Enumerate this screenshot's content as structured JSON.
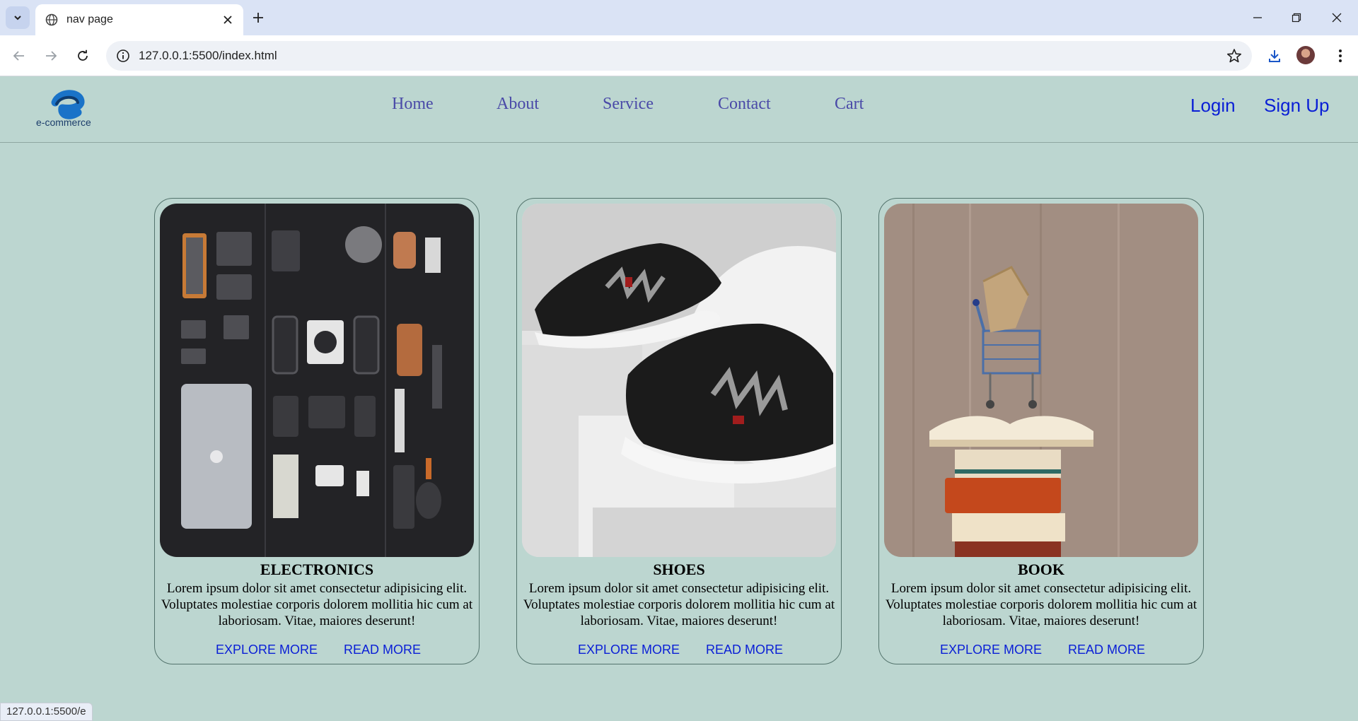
{
  "browser": {
    "tab_title": "nav page",
    "url": "127.0.0.1:5500/index.html",
    "status_url": "127.0.0.1:5500/e"
  },
  "site": {
    "logo_text": "e-commerce",
    "nav": [
      "Home",
      "About",
      "Service",
      "Contact",
      "Cart"
    ],
    "auth": {
      "login": "Login",
      "signup": "Sign Up"
    }
  },
  "cards": [
    {
      "title": "ELECTRONICS",
      "description": "Lorem ipsum dolor sit amet consectetur adipisicing elit. Voluptates molestiae corporis dolorem mollitia hic cum at laboriosam. Vitae, maiores deserunt!",
      "explore": "EXPLORE MORE",
      "read": "READ MORE"
    },
    {
      "title": "SHOES",
      "description": "Lorem ipsum dolor sit amet consectetur adipisicing elit. Voluptates molestiae corporis dolorem mollitia hic cum at laboriosam. Vitae, maiores deserunt!",
      "explore": "EXPLORE MORE",
      "read": "READ MORE"
    },
    {
      "title": "BOOK",
      "description": "Lorem ipsum dolor sit amet consectetur adipisicing elit. Voluptates molestiae corporis dolorem mollitia hic cum at laboriosam. Vitae, maiores deserunt!",
      "explore": "EXPLORE MORE",
      "read": "READ MORE"
    }
  ],
  "colors": {
    "page_background": "#bcd6d0",
    "nav_link": "#4a4aa8",
    "link_blue": "#0a1fd6"
  }
}
